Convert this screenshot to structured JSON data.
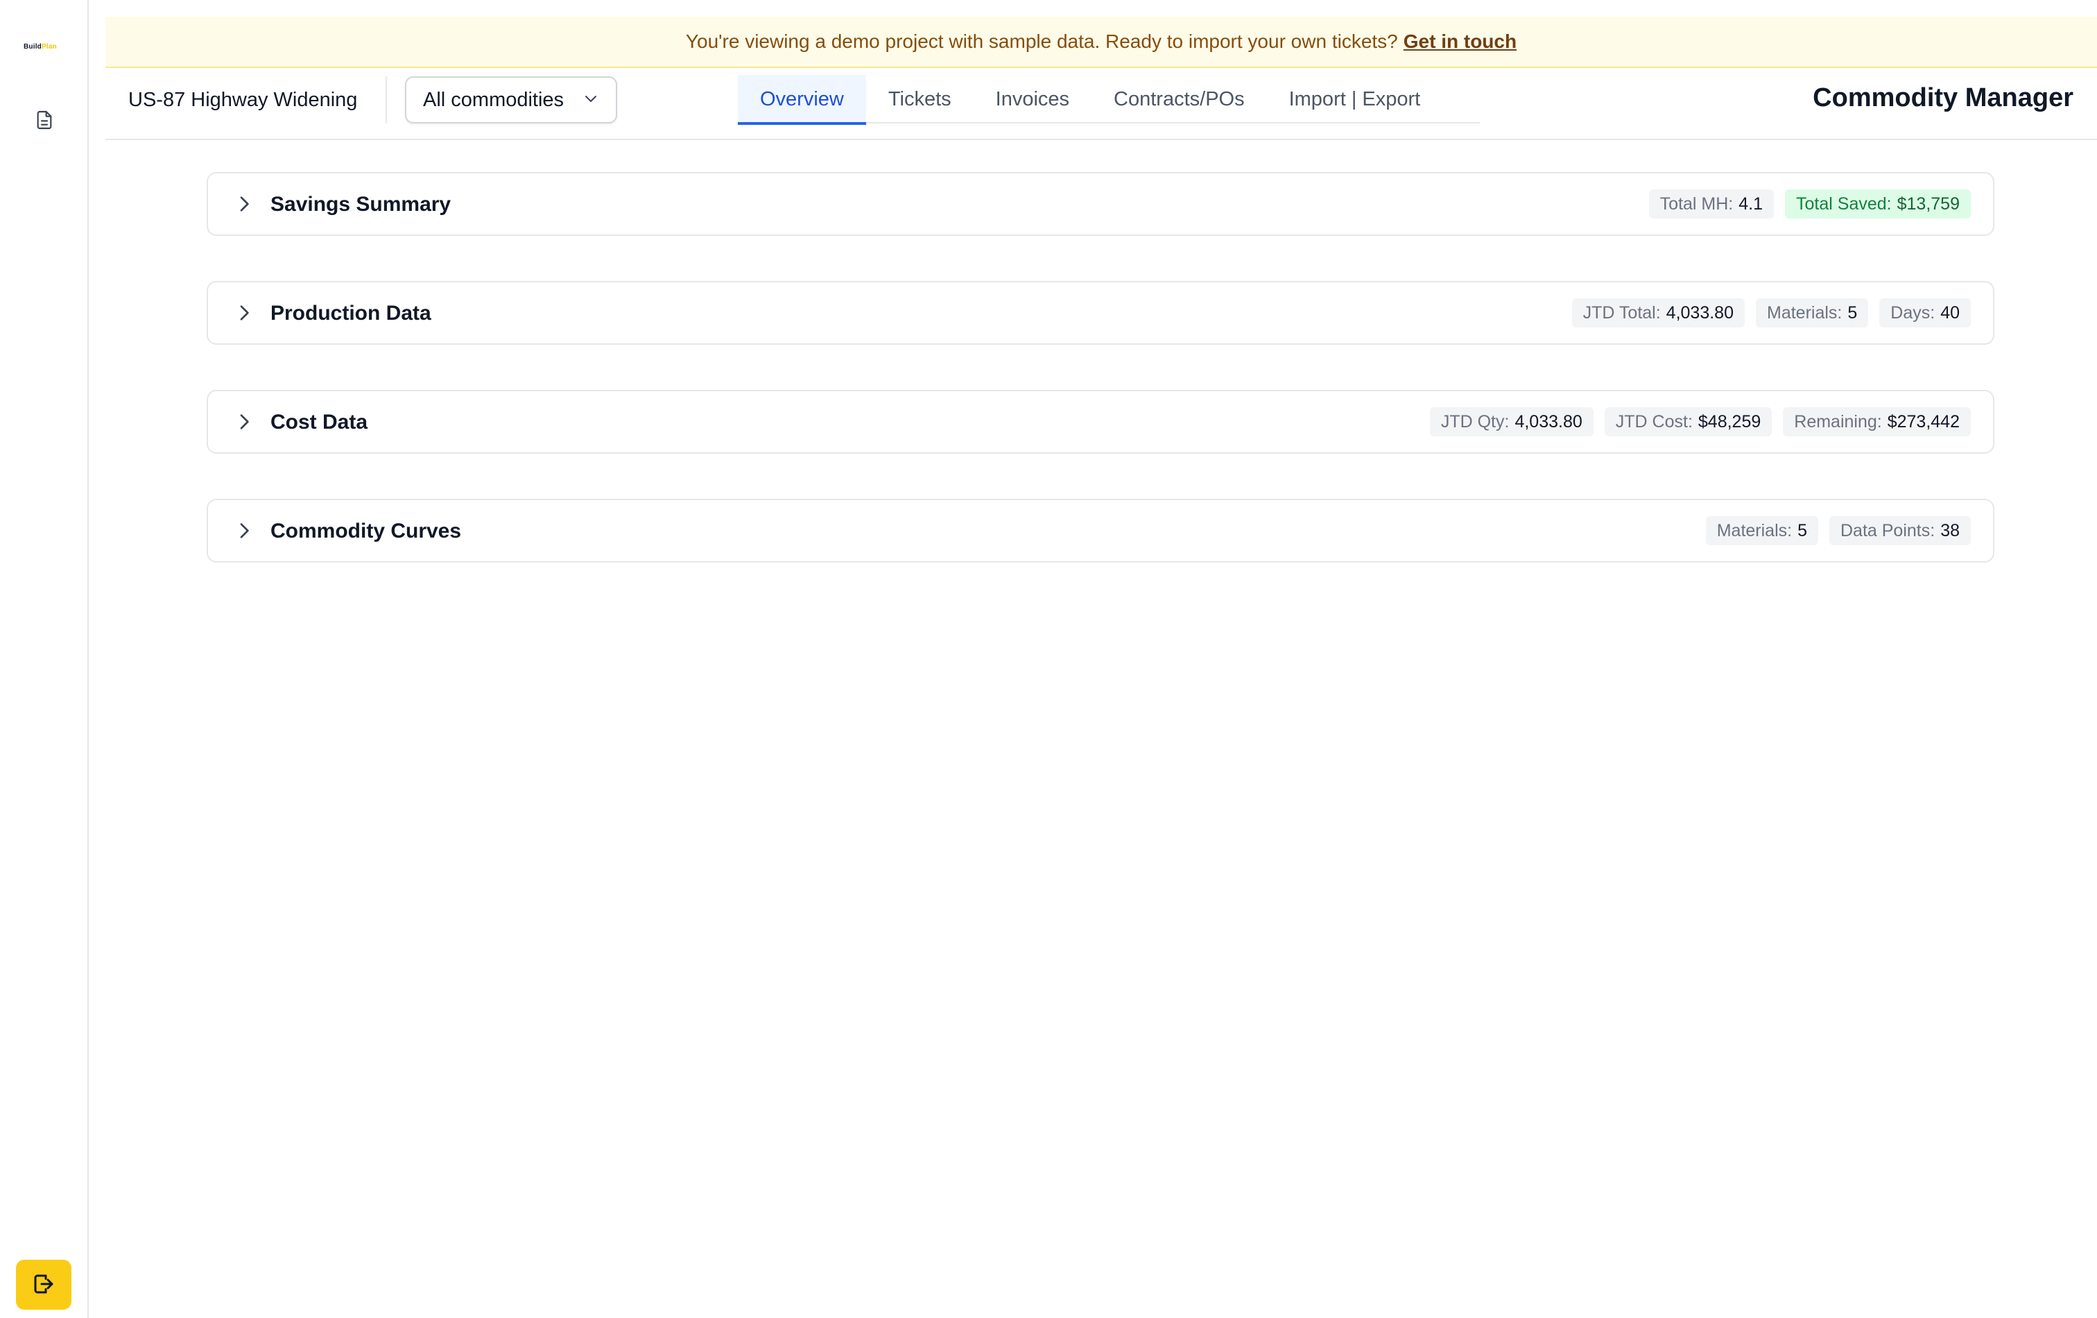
{
  "sidebar": {
    "logo_part1": "Build",
    "logo_part2": "Plan",
    "logo_color_1": "#111827",
    "logo_color_2": "#f5c400",
    "nav_icon": "document-icon",
    "exit_icon": "sign-out-icon",
    "exit_button_color": "#facc15"
  },
  "banner": {
    "text": "You're viewing a demo project with sample data. Ready to import your own tickets?",
    "link": "Get in touch"
  },
  "header": {
    "project_name": "US-87 Highway Widening",
    "commodity_select": {
      "value": "All commodities",
      "icon": "chevron-down-icon"
    },
    "tabs": [
      {
        "label": "Overview",
        "active": true
      },
      {
        "label": "Tickets",
        "active": false
      },
      {
        "label": "Invoices",
        "active": false
      },
      {
        "label": "Contracts/POs",
        "active": false
      },
      {
        "label": "Import | Export",
        "active": false
      }
    ],
    "app_title": "Commodity Manager"
  },
  "colors": {
    "accent_blue": "#2563eb",
    "savings_green": "#15803d",
    "banner_bg": "#fefce8"
  },
  "sections": [
    {
      "title": "Savings Summary",
      "badges": [
        {
          "label": "Total MH:",
          "value": "4.1"
        },
        {
          "label": "Total Saved:",
          "value": "$13,759",
          "tone": "green"
        }
      ]
    },
    {
      "title": "Production Data",
      "badges": [
        {
          "label": "JTD Total:",
          "value": "4,033.80"
        },
        {
          "label": "Materials:",
          "value": "5"
        },
        {
          "label": "Days:",
          "value": "40"
        }
      ]
    },
    {
      "title": "Cost Data",
      "badges": [
        {
          "label": "JTD Qty:",
          "value": "4,033.80"
        },
        {
          "label": "JTD Cost:",
          "value": "$48,259"
        },
        {
          "label": "Remaining:",
          "value": "$273,442"
        }
      ]
    },
    {
      "title": "Commodity Curves",
      "badges": [
        {
          "label": "Materials:",
          "value": "5"
        },
        {
          "label": "Data Points:",
          "value": "38"
        }
      ]
    }
  ]
}
